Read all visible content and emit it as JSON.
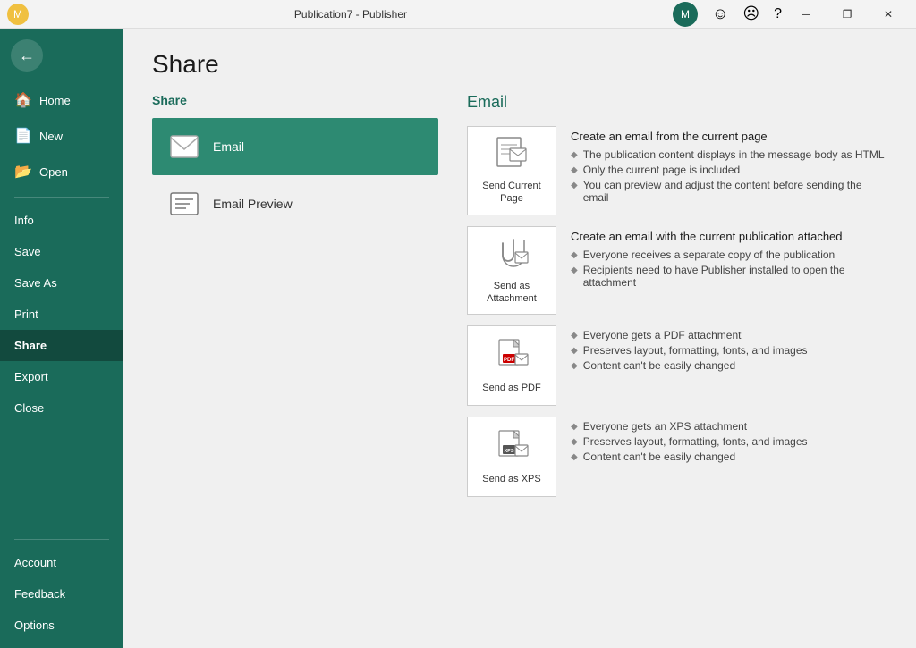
{
  "titlebar": {
    "title": "Publication7 - Publisher",
    "icons": [
      "😊",
      "😐",
      "?"
    ],
    "controls": [
      "─",
      "❐",
      "✕"
    ]
  },
  "sidebar": {
    "back_label": "←",
    "nav_top": [
      {
        "id": "home",
        "label": "Home",
        "icon": "🏠"
      },
      {
        "id": "new",
        "label": "New",
        "icon": "📄"
      },
      {
        "id": "open",
        "label": "Open",
        "icon": "📂"
      }
    ],
    "nav_mid": [
      {
        "id": "info",
        "label": "Info"
      },
      {
        "id": "save",
        "label": "Save"
      },
      {
        "id": "save-as",
        "label": "Save As"
      },
      {
        "id": "print",
        "label": "Print"
      },
      {
        "id": "share",
        "label": "Share",
        "active": true
      },
      {
        "id": "export",
        "label": "Export"
      },
      {
        "id": "close",
        "label": "Close"
      }
    ],
    "nav_bottom": [
      {
        "id": "account",
        "label": "Account"
      },
      {
        "id": "feedback",
        "label": "Feedback"
      },
      {
        "id": "options",
        "label": "Options"
      }
    ]
  },
  "page": {
    "title": "Share",
    "left_section_title": "Share",
    "left_options": [
      {
        "id": "email",
        "label": "Email",
        "icon": "✉",
        "selected": true
      },
      {
        "id": "email-preview",
        "label": "Email Preview",
        "icon": "📋",
        "selected": false
      }
    ],
    "right_section_title": "Email",
    "email_options": [
      {
        "id": "send-current-page",
        "box_label": "Send Current\nPage",
        "main_desc": "Create an email from the current page",
        "bullets": [
          "The publication content displays in the message body as HTML",
          "Only the current page is included",
          "You can preview and adjust the content before sending the email"
        ],
        "icon_type": "page"
      },
      {
        "id": "send-attachment",
        "box_label": "Send as\nAttachment",
        "main_desc": "Create an email with the current publication attached",
        "bullets": [
          "Everyone receives a separate copy of the publication",
          "Recipients need to have Publisher installed to open the attachment"
        ],
        "icon_type": "attach"
      },
      {
        "id": "send-pdf",
        "box_label": "Send as PDF",
        "main_desc": "",
        "bullets": [
          "Everyone gets a PDF attachment",
          "Preserves layout, formatting, fonts, and images",
          "Content can't be easily changed"
        ],
        "icon_type": "pdf"
      },
      {
        "id": "send-xps",
        "box_label": "Send as XPS",
        "main_desc": "",
        "bullets": [
          "Everyone gets an XPS attachment",
          "Preserves layout, formatting, fonts, and images",
          "Content can't be easily changed"
        ],
        "icon_type": "xps"
      }
    ]
  }
}
